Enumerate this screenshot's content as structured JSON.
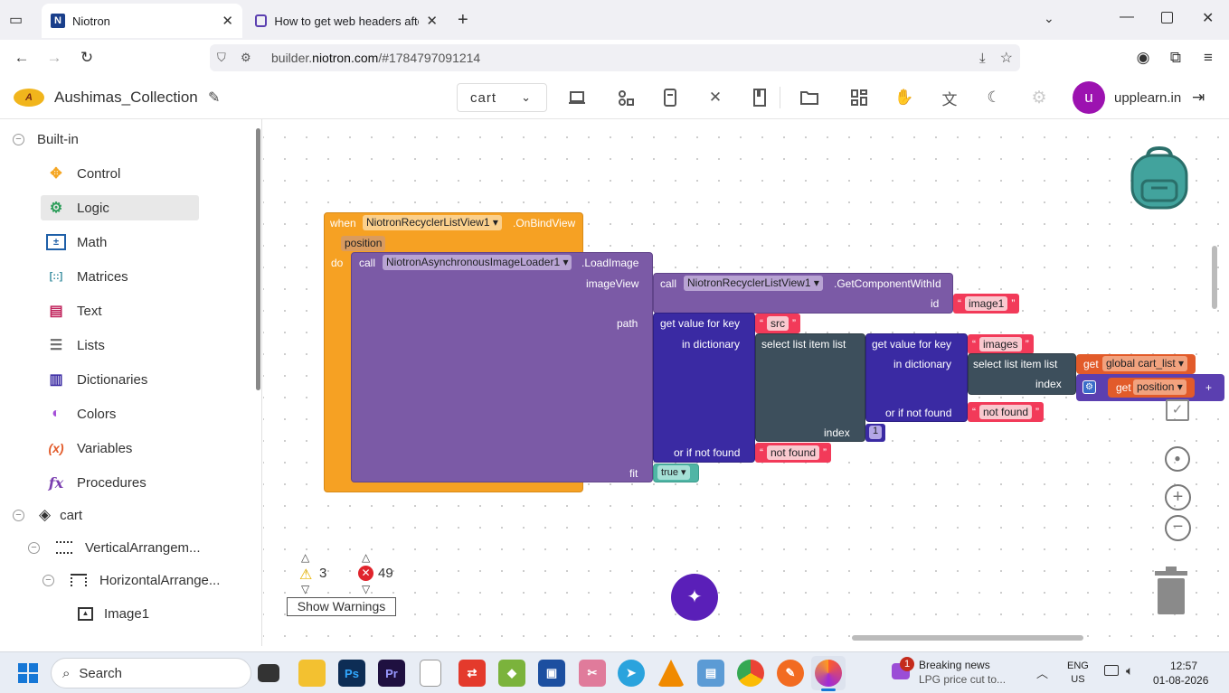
{
  "browser": {
    "tabs": [
      {
        "title": "Niotron",
        "active": true
      },
      {
        "title": "How to get web headers after s",
        "active": false
      }
    ],
    "url_prefix": "builder.",
    "url_domain": "niotron.com",
    "url_rest": "/#1784797091214"
  },
  "app": {
    "project_name": "Aushimas_Collection",
    "screen_select": "cart",
    "user_initial": "u",
    "user_name": "upplearn.in"
  },
  "sidebar": {
    "root": "Built-in",
    "categories": [
      {
        "label": "Control",
        "icon": "control-icon",
        "color": "#f5a623"
      },
      {
        "label": "Logic",
        "icon": "logic-icon",
        "color": "#2e9e5b"
      },
      {
        "label": "Math",
        "icon": "math-icon",
        "color": "#1e5fa8"
      },
      {
        "label": "Matrices",
        "icon": "matrices-icon",
        "color": "#3b8fa0"
      },
      {
        "label": "Text",
        "icon": "text-icon",
        "color": "#c0245c"
      },
      {
        "label": "Lists",
        "icon": "lists-icon",
        "color": "#6b6b6b"
      },
      {
        "label": "Dictionaries",
        "icon": "dictionaries-icon",
        "color": "#3a2aa3"
      },
      {
        "label": "Colors",
        "icon": "colors-icon",
        "color": "#a54fd8"
      },
      {
        "label": "Variables",
        "icon": "variables-icon",
        "color": "#e25b2a"
      },
      {
        "label": "Procedures",
        "icon": "procedures-icon",
        "color": "#7b3fb0"
      }
    ],
    "screen": "cart",
    "components": [
      "VerticalArrangem...",
      "HorizontalArrange...",
      "Image1"
    ]
  },
  "blocks": {
    "event": {
      "when": "when",
      "component": "NiotronRecyclerListView1",
      "event": ".OnBindView",
      "param": "position",
      "do": "do"
    },
    "call1": {
      "call": "call",
      "component": "NiotronAsynchronousImageLoader1",
      "method": ".LoadImage",
      "arg_imageView": "imageView",
      "arg_path": "path",
      "arg_fit": "fit"
    },
    "call2": {
      "call": "call",
      "component": "NiotronRecyclerListView1",
      "method": ".GetComponentWithId",
      "arg_id": "id",
      "id_value": "image1"
    },
    "dict1": {
      "label": "get value for key",
      "key": "src",
      "in_dict": "in dictionary",
      "or_not": "or if not found",
      "not_found": "not found"
    },
    "select1": {
      "label": "select list item list",
      "index": "index",
      "index_value": "1"
    },
    "dict2": {
      "label": "get value for key",
      "key": "images",
      "in_dict": "in dictionary",
      "or_not": "or if not found",
      "not_found": "not found"
    },
    "select2": {
      "label": "select list item list",
      "index": "index"
    },
    "get_global": {
      "get": "get",
      "var": "global cart_list"
    },
    "get_position": {
      "get": "get",
      "var": "position",
      "op": "+"
    },
    "fit_value": "true"
  },
  "warnings": {
    "warning_count": "3",
    "error_count": "49",
    "show_button": "Show Warnings"
  },
  "taskbar": {
    "search": "Search",
    "news_title": "Breaking news",
    "news_sub": "LPG price cut to...",
    "news_badge": "1",
    "lang1": "ENG",
    "lang2": "US",
    "time": "12:57",
    "date": "01-08-2026"
  }
}
